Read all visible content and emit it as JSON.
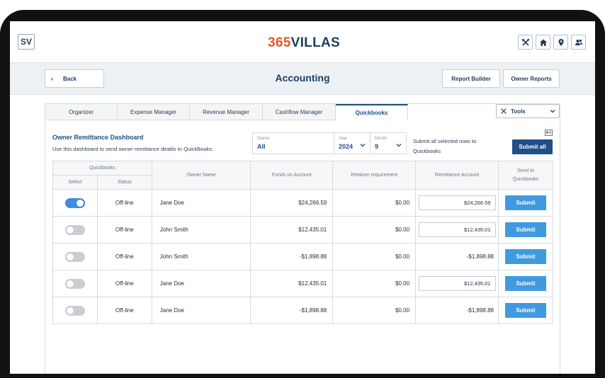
{
  "topbar": {
    "badge": "SV",
    "logo_number": "365",
    "logo_word": "VILLAS",
    "icons": [
      "tools-icon",
      "home-icon",
      "location-pin-icon",
      "users-icon"
    ]
  },
  "header": {
    "back_label": "Back",
    "title": "Accounting",
    "report_builder": "Report Builder",
    "owner_reports": "Owner Reports"
  },
  "tabs": [
    "Organizer",
    "Expense Manager",
    "Revenue Manager",
    "Cashflow Manager",
    "Quickbooks"
  ],
  "active_tab": "Quickbooks",
  "tools_label": "Tools",
  "dashboard": {
    "title": "Owner Remittance Dashboard",
    "description": "Use this dashboard to send owner remittance deatils to QuickBooks.",
    "owner_label": "Owner",
    "owner_value": "All",
    "year_label": "Year",
    "year_value": "2024",
    "month_label": "Month",
    "month_value": "9",
    "submit_note": "Submit all selected rows to Quickbooks",
    "submit_all": "Submit all"
  },
  "table": {
    "group_header": "Quickbooks",
    "headers": {
      "select": "Select",
      "status": "Status",
      "owner": "Owner Name",
      "funds": "Funds on Account",
      "retainer": "Retainer requirement",
      "remittance": "Remittance Account",
      "send": "Send to Quickbooks"
    },
    "rows": [
      {
        "selected": true,
        "status": "Off-line",
        "owner": "Jane Doe",
        "funds": "$24,266.59",
        "retainer": "$0.00",
        "remittance": "$24,266.59",
        "remittance_negative": false,
        "button": "Submit"
      },
      {
        "selected": false,
        "status": "Off-line",
        "owner": "John Smith",
        "funds": "$12,435.01",
        "retainer": "$0.00",
        "remittance": "$12,435.01",
        "remittance_negative": false,
        "button": "Submit"
      },
      {
        "selected": false,
        "status": "Off-line",
        "owner": "John Smith",
        "funds": "-$1,898.88",
        "retainer": "$0.00",
        "remittance": "-$1,898.88",
        "remittance_negative": true,
        "button": "Submit"
      },
      {
        "selected": false,
        "status": "Off-line",
        "owner": "Jane Doe",
        "funds": "$12,435.01",
        "retainer": "$0.00",
        "remittance": "$12,435.01",
        "remittance_negative": false,
        "button": "Submit"
      },
      {
        "selected": false,
        "status": "Off-line",
        "owner": "Jane Doe",
        "funds": "-$1,898.88",
        "retainer": "$0.00",
        "remittance": "-$1,898.88",
        "remittance_negative": true,
        "button": "Submit"
      }
    ]
  },
  "colors": {
    "brand_orange": "#e05a2a",
    "brand_navy": "#1e3f63",
    "accent_blue": "#3f9ae0",
    "negative": "#e0613a"
  }
}
